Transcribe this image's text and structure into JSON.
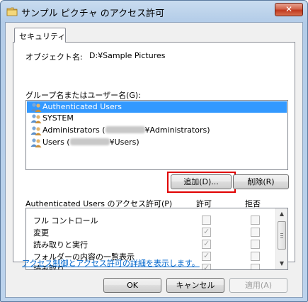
{
  "window": {
    "title": "サンプル ピクチャ のアクセス許可",
    "close_label": "✕"
  },
  "tabs": [
    {
      "label": "セキュリティ"
    }
  ],
  "object": {
    "label": "オブジェクト名:",
    "value": "D:¥Sample Pictures"
  },
  "groups": {
    "label": "グループ名またはユーザー名(G):",
    "items": [
      {
        "prefix": "Authenticated Users",
        "suffix": ""
      },
      {
        "prefix": "SYSTEM",
        "suffix": ""
      },
      {
        "prefix": "Administrators (",
        "suffix": "¥Administrators)"
      },
      {
        "prefix": "Users (",
        "suffix": "¥Users)"
      }
    ]
  },
  "buttons": {
    "add": "追加(D)...",
    "remove": "削除(R)",
    "ok": "OK",
    "cancel": "キャンセル",
    "apply": "適用(A)"
  },
  "permissions": {
    "header": "Authenticated Users のアクセス許可(P)",
    "allow_label": "許可",
    "deny_label": "拒否",
    "rows": [
      {
        "name": "フル コントロール",
        "allow": false,
        "deny": false
      },
      {
        "name": "変更",
        "allow": true,
        "deny": false
      },
      {
        "name": "読み取りと実行",
        "allow": true,
        "deny": false
      },
      {
        "name": "フォルダーの内容の一覧表示",
        "allow": true,
        "deny": false
      },
      {
        "name": "読み取り",
        "allow": true,
        "deny": false
      }
    ]
  },
  "link": {
    "text": "アクセス制御とアクセス許可の詳細を表示します。"
  },
  "colors": {
    "selection": "#3399ff",
    "highlight_border": "#e00000",
    "link": "#0066cc"
  }
}
